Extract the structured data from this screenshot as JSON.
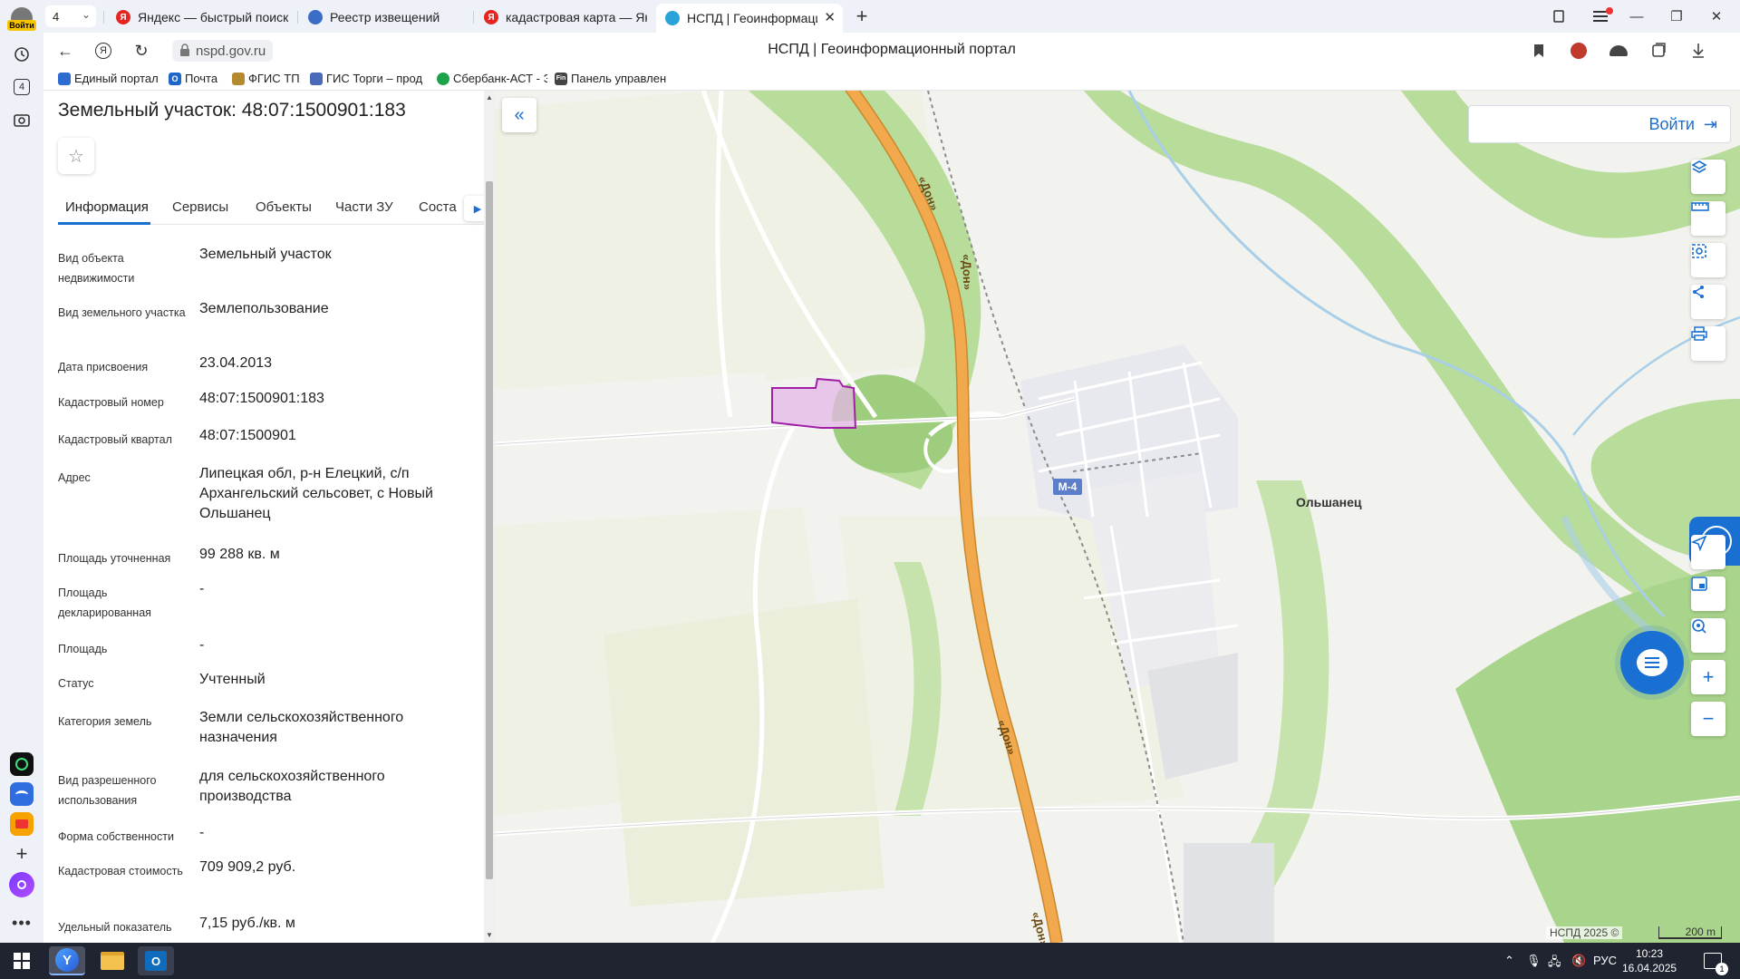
{
  "browser": {
    "rail": {
      "login_label": "Войти",
      "tabs_count": "4"
    },
    "tab_count": "4",
    "tabs": [
      {
        "title": "Яндекс — быстрый поиск",
        "fav_color": "#e52620",
        "fav_letter": "Я"
      },
      {
        "title": "Реестр извещений",
        "fav_color": "#3b6cc6",
        "fav_letter": ""
      },
      {
        "title": "кадастровая карта — Янде",
        "fav_color": "#e52620",
        "fav_letter": "Я"
      },
      {
        "title": "НСПД | Геоинформаци",
        "fav_color": "#2aa3d9",
        "fav_letter": ""
      }
    ],
    "url": "nspd.gov.ru",
    "page_title": "НСПД | Геоинформационный портал",
    "bookmarks": [
      {
        "label": "Единый портал",
        "color": "#2d6bd1"
      },
      {
        "label": "Почта",
        "color": "#1e66c8"
      },
      {
        "label": "ФГИС ТП",
        "color": "#b58a2f"
      },
      {
        "label": "ГИС Торги – прод",
        "color": "#4a69b8"
      },
      {
        "label": "Сбербанк-АСТ - Э",
        "color": "#1ca34a"
      },
      {
        "label": "Панель управлен",
        "color": "#444444"
      }
    ]
  },
  "panel": {
    "title": "Земельный участок: 48:07:1500901:183",
    "tabs": [
      "Информация",
      "Сервисы",
      "Объекты",
      "Части ЗУ",
      "Соста"
    ],
    "rows": [
      {
        "label": "Вид объекта недвижимости",
        "value": "Земельный участок"
      },
      {
        "label": "Вид земельного участка",
        "value": "Землепользование"
      },
      {
        "label": "Дата присвоения",
        "value": "23.04.2013"
      },
      {
        "label": "Кадастровый номер",
        "value": "48:07:1500901:183"
      },
      {
        "label": "Кадастровый квартал",
        "value": "48:07:1500901"
      },
      {
        "label": "Адрес",
        "value": "Липецкая обл, р-н Елецкий, с/п Архангельский сельсовет, с Новый Ольшанец"
      },
      {
        "label": "Площадь уточненная",
        "value": "99 288 кв. м"
      },
      {
        "label": "Площадь декларированная",
        "value": "-"
      },
      {
        "label": "Площадь",
        "value": "-"
      },
      {
        "label": "Статус",
        "value": "Учтенный"
      },
      {
        "label": "Категория земель",
        "value": "Земли сельскохозяйственного назначения"
      },
      {
        "label": "Вид разрешенного использования",
        "value": "для сельскохозяйственного производства"
      },
      {
        "label": "Форма собственности",
        "value": "-"
      },
      {
        "label": "Кадастровая стоимость",
        "value": "709 909,2 руб."
      },
      {
        "label": "Удельный показатель",
        "value": "7,15 руб./кв. м"
      }
    ]
  },
  "map": {
    "login_label": "Войти",
    "village_label": "Ольшанец",
    "road_name": "«Дон»",
    "road_number": "М-4",
    "copyright": "НСПД 2025 ©",
    "scale": "200 m",
    "colors": {
      "accent": "#1a6fd3",
      "road": "#f2a94e",
      "parcel": "#a01fa6",
      "forest": "#b8dc9a"
    }
  },
  "taskbar": {
    "lang": "РУС",
    "time": "10:23",
    "date": "16.04.2025",
    "notifications": "1"
  }
}
